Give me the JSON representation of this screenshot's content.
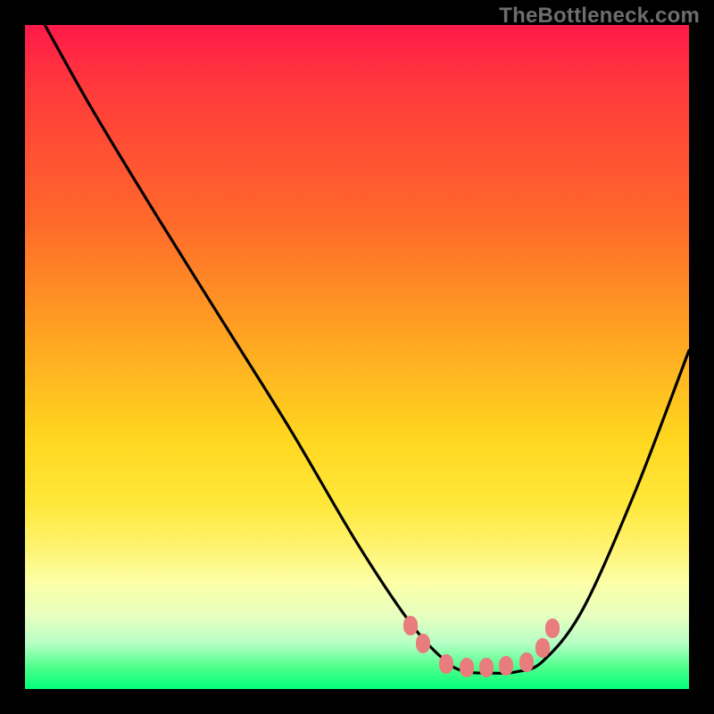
{
  "watermark": "TheBottleneck.com",
  "chart_data": {
    "type": "line",
    "title": "",
    "xlabel": "",
    "ylabel": "",
    "xlim": [
      0,
      100
    ],
    "ylim": [
      0,
      100
    ],
    "grid": false,
    "legend": false,
    "background_gradient": {
      "top": "#ff2247",
      "middle": "#ffe23a",
      "bottom": "#00ff78"
    },
    "series": [
      {
        "name": "bottleneck-curve",
        "color": "#000000",
        "x": [
          3,
          10,
          20,
          30,
          40,
          50,
          58,
          63,
          66,
          70,
          74,
          78,
          84,
          92,
          100
        ],
        "values": [
          100,
          87.5,
          71,
          55,
          39,
          22,
          10,
          4.5,
          2.7,
          2.4,
          2.6,
          4.2,
          12,
          30,
          51
        ]
      }
    ],
    "markers": [
      {
        "name": "left-shoulder-marker-1",
        "x": 58.0,
        "y": 9.6
      },
      {
        "name": "left-shoulder-marker-2",
        "x": 60.0,
        "y": 6.8
      },
      {
        "name": "flat-marker-1",
        "x": 63.5,
        "y": 3.8
      },
      {
        "name": "flat-marker-2",
        "x": 66.5,
        "y": 3.2
      },
      {
        "name": "flat-marker-3",
        "x": 69.5,
        "y": 3.2
      },
      {
        "name": "flat-marker-4",
        "x": 72.5,
        "y": 3.5
      },
      {
        "name": "flat-marker-5",
        "x": 75.5,
        "y": 4.0
      },
      {
        "name": "right-shoulder-marker-1",
        "x": 78.0,
        "y": 6.2
      },
      {
        "name": "right-shoulder-marker-2",
        "x": 79.5,
        "y": 9.2
      }
    ]
  }
}
